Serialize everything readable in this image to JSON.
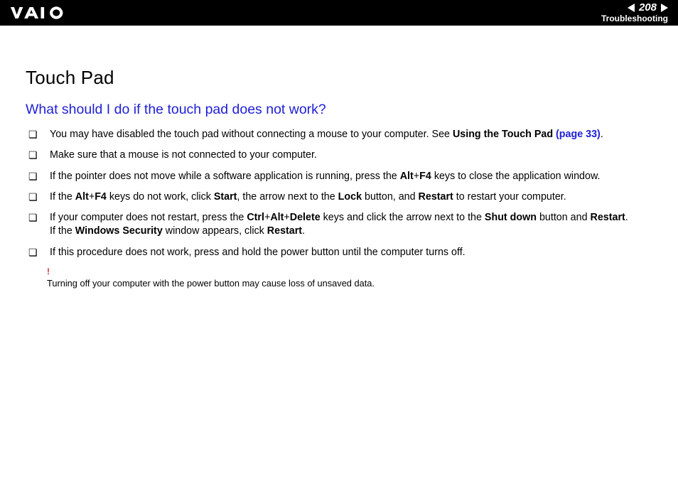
{
  "header": {
    "page_number": "208",
    "section": "Troubleshooting"
  },
  "title": "Touch Pad",
  "question": "What should I do if the touch pad does not work?",
  "steps": {
    "s1_a": "You may have disabled the touch pad without connecting a mouse to your computer. See ",
    "s1_b_bold": "Using the Touch Pad ",
    "s1_c_link": "(page 33)",
    "s1_d": ".",
    "s2": "Make sure that a mouse is not connected to your computer.",
    "s3_a": "If the pointer does not move while a software application is running, press the ",
    "s3_b_bold": "Alt",
    "s3_c": "+",
    "s3_d_bold": "F4",
    "s3_e": " keys to close the application window.",
    "s4_a": "If the ",
    "s4_b_bold": "Alt",
    "s4_c": "+",
    "s4_d_bold": "F4",
    "s4_e": " keys do not work, click ",
    "s4_f_bold": "Start",
    "s4_g": ", the arrow next to the ",
    "s4_h_bold": "Lock",
    "s4_i": " button, and ",
    "s4_j_bold": "Restart",
    "s4_k": " to restart your computer.",
    "s5_a": "If your computer does not restart, press the ",
    "s5_b_bold": "Ctrl",
    "s5_c": "+",
    "s5_d_bold": "Alt",
    "s5_e": "+",
    "s5_f_bold": "Delete",
    "s5_g": " keys and click the arrow next to the ",
    "s5_h_bold": "Shut down",
    "s5_i": " button and ",
    "s5_j_bold": "Restart",
    "s5_k": ".",
    "s5_l": "If the ",
    "s5_m_bold": "Windows Security",
    "s5_n": " window appears, click ",
    "s5_o_bold": "Restart",
    "s5_p": ".",
    "s6": "If this procedure does not work, press and hold the power button until the computer turns off."
  },
  "warning": {
    "mark": "!",
    "text": "Turning off your computer with the power button may cause loss of unsaved data."
  }
}
